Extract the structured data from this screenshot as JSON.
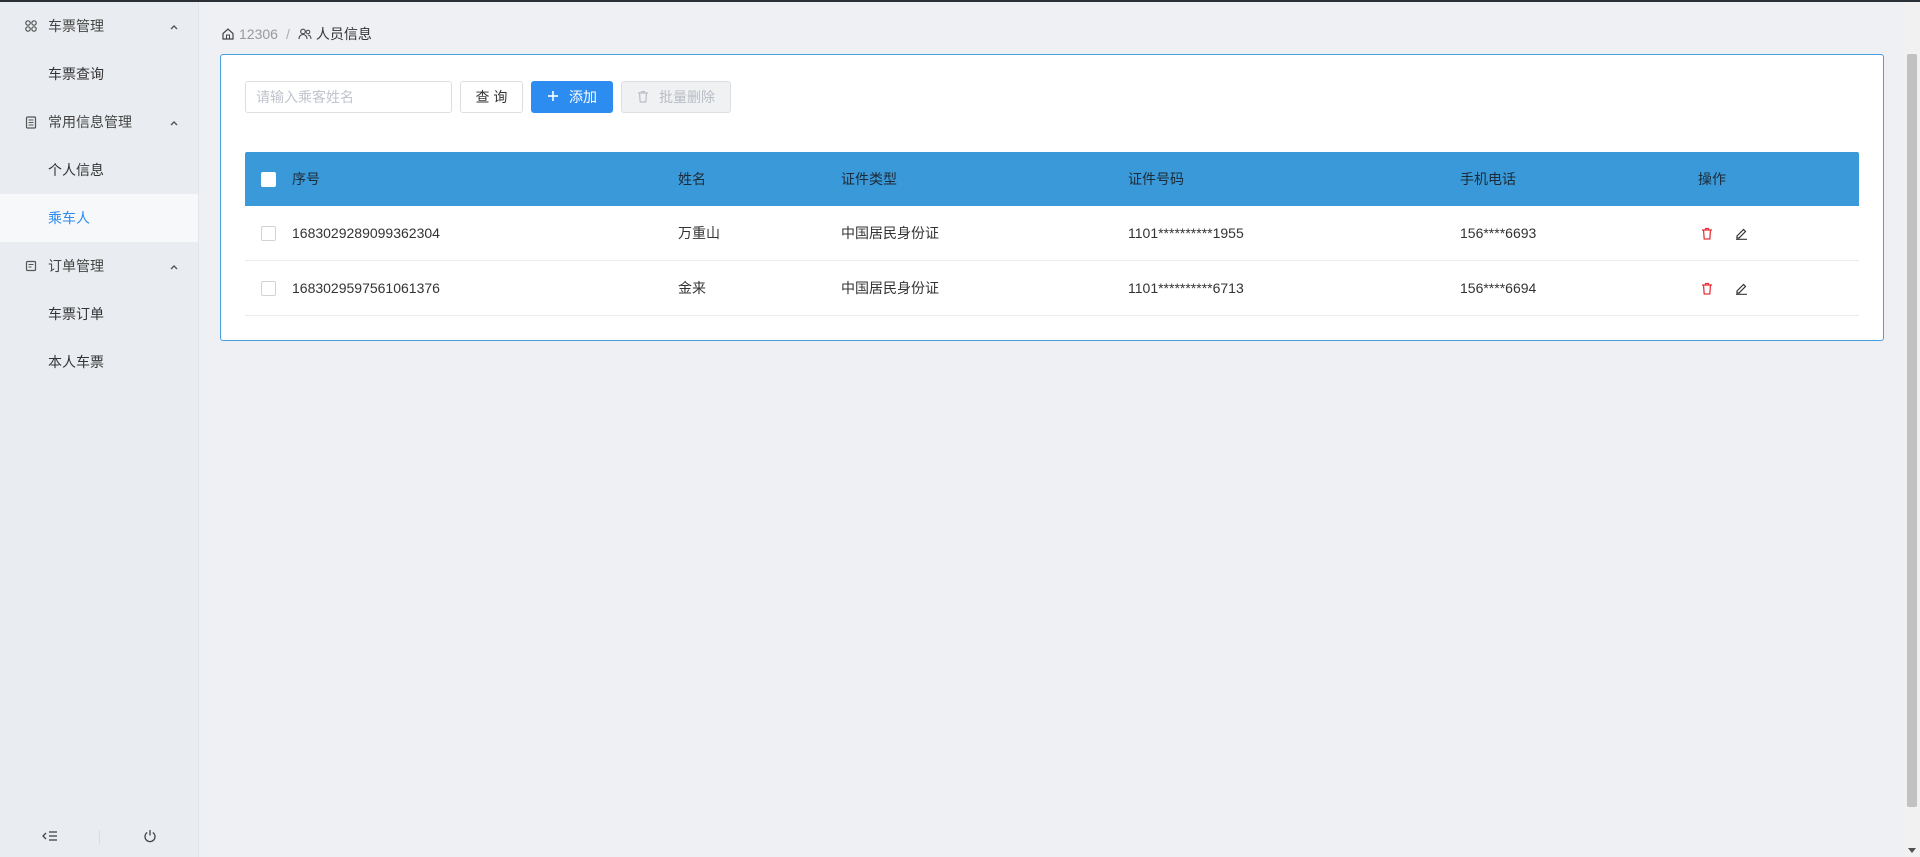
{
  "sidebar": {
    "groups": [
      {
        "label": "车票管理",
        "icon": "grid-icon",
        "items": [
          {
            "label": "车票查询",
            "active": false
          }
        ]
      },
      {
        "label": "常用信息管理",
        "icon": "document-icon",
        "items": [
          {
            "label": "个人信息",
            "active": false
          },
          {
            "label": "乘车人",
            "active": true
          }
        ]
      },
      {
        "label": "订单管理",
        "icon": "order-icon",
        "items": [
          {
            "label": "车票订单",
            "active": false
          },
          {
            "label": "本人车票",
            "active": false
          }
        ]
      }
    ]
  },
  "breadcrumb": {
    "home": "12306",
    "current": "人员信息"
  },
  "toolbar": {
    "search_placeholder": "请输入乘客姓名",
    "query_label": "查 询",
    "add_label": "添加",
    "batch_delete_label": "批量删除"
  },
  "table": {
    "headers": {
      "seq": "序号",
      "name": "姓名",
      "id_type": "证件类型",
      "id_no": "证件号码",
      "phone": "手机电话",
      "actions": "操作"
    },
    "rows": [
      {
        "seq": "1683029289099362304",
        "name": "万重山",
        "id_type": "中国居民身份证",
        "id_no": "1101**********1955",
        "phone": "156****6693"
      },
      {
        "seq": "1683029597561061376",
        "name": "金来",
        "id_type": "中国居民身份证",
        "id_no": "1101**********6713",
        "phone": "156****6694"
      }
    ]
  },
  "colors": {
    "accent": "#2d8cf0",
    "table_header": "#3a9ad9",
    "delete": "#e8343a"
  }
}
